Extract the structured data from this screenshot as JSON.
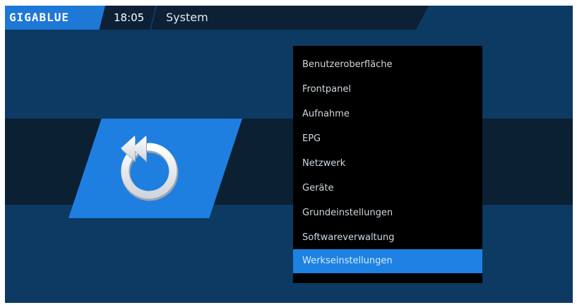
{
  "header": {
    "logo": "GIGABLUE",
    "time": "18:05",
    "title": "System"
  },
  "tile": {
    "icon": "restore-icon"
  },
  "menu": {
    "selected_index": 8,
    "items": [
      {
        "label": "Benutzeroberfläche"
      },
      {
        "label": "Frontpanel"
      },
      {
        "label": "Aufnahme"
      },
      {
        "label": "EPG"
      },
      {
        "label": "Netzwerk"
      },
      {
        "label": "Geräte"
      },
      {
        "label": "Grundeinstellungen"
      },
      {
        "label": "Softwareverwaltung"
      },
      {
        "label": "Werkseinstellungen"
      }
    ]
  },
  "colors": {
    "background": "#0c3a62",
    "band": "#0b2032",
    "accent": "#1e7fe0",
    "menu_bg": "#000000"
  }
}
